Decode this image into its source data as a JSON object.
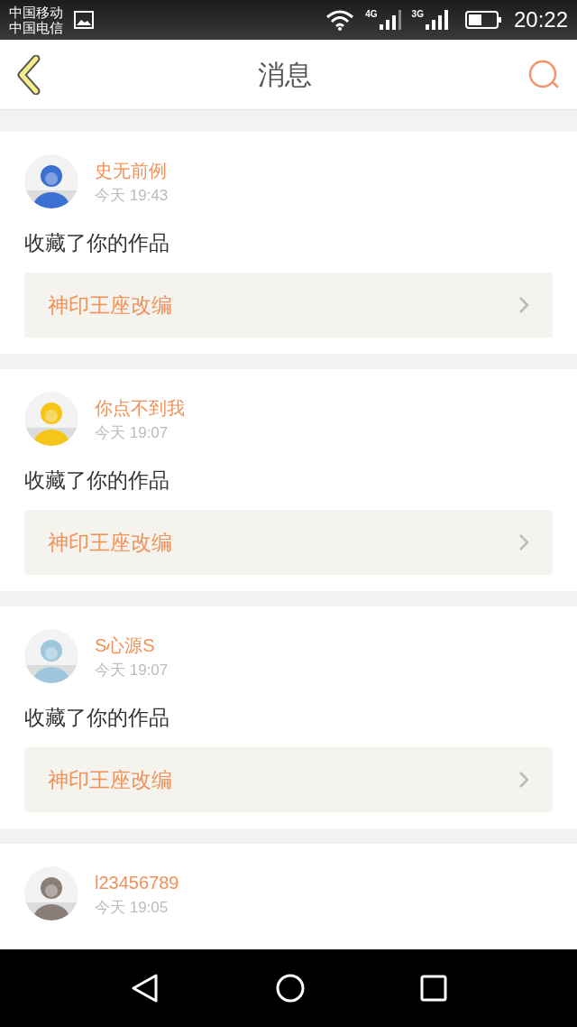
{
  "status_bar": {
    "carriers": [
      "中国移动",
      "中国电信"
    ],
    "network_1": "4G",
    "network_2": "3G",
    "time": "20:22"
  },
  "header": {
    "title": "消息"
  },
  "messages": [
    {
      "name": "史无前例",
      "time": "今天 19:43",
      "action": "收藏了你的作品",
      "work": "神印王座改编"
    },
    {
      "name": "你点不到我",
      "time": "今天 19:07",
      "action": "收藏了你的作品",
      "work": "神印王座改编"
    },
    {
      "name": "S心源S",
      "time": "今天 19:07",
      "action": "收藏了你的作品",
      "work": "神印王座改编"
    },
    {
      "name": "l23456789",
      "time": "今天 19:05"
    }
  ]
}
